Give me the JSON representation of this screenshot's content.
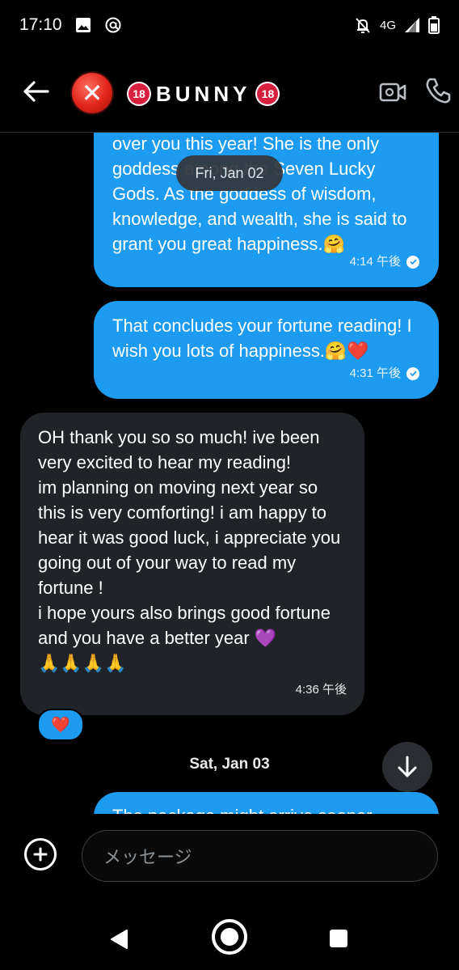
{
  "status_bar": {
    "time": "17:10",
    "network": "4G",
    "icons": [
      "image-icon",
      "at-icon",
      "notifications-off-icon",
      "signal-icon",
      "battery-icon"
    ]
  },
  "header": {
    "back_icon": "arrow-left-icon",
    "contact_name": "BUNNY",
    "name_badge": "18",
    "video_icon": "video-camera-icon",
    "call_icon": "phone-icon"
  },
  "messages": [
    {
      "direction": "sent",
      "text": "over you this year! She is the only goddess among the Seven Lucky Gods. As the goddess of wisdom, knowledge, and wealth, she is said to grant you great happiness.🤗",
      "time": "4:14 午後",
      "read": true
    },
    {
      "direction": "sent",
      "text": "That concludes your fortune reading! I wish you lots of happiness.🤗❤️",
      "time": "4:31 午後",
      "read": true
    },
    {
      "direction": "received",
      "text": "OH thank you so so much! ive been very excited to hear my reading!\nim planning on moving next year so this is very comforting! i am happy to hear it was good luck, i appreciate you going out of your way to read my fortune !\ni hope yours also brings good fortune and you have a better year 💜\n🙏🙏🙏🙏",
      "time": "4:36 午後",
      "reaction": "❤️"
    },
    {
      "direction": "sent",
      "text": "The package might arrive sooner"
    }
  ],
  "date_pill": "Fri, Jan 02",
  "date_separator": "Sat, Jan 03",
  "scroll_down_icon": "arrow-down-icon",
  "composer": {
    "add_icon": "plus-circle-icon",
    "placeholder": "メッセージ"
  },
  "navbar": {
    "icons": [
      "back-triangle-icon",
      "home-circle-icon",
      "recents-square-icon"
    ]
  },
  "colors": {
    "sent_bubble": "#1d9bf0",
    "received_bubble": "#202327",
    "background": "#000000"
  }
}
